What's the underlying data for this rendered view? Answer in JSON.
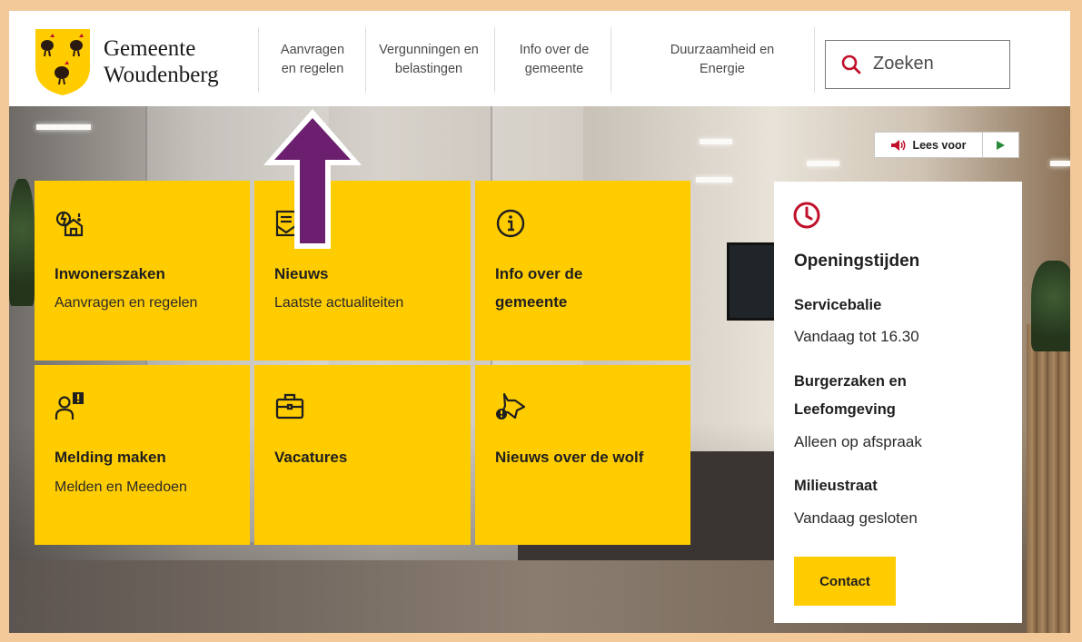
{
  "brand": {
    "line1": "Gemeente",
    "line2": "Woudenberg"
  },
  "nav": [
    {
      "label": "Aanvragen en regelen"
    },
    {
      "label": "Vergunningen en belastingen"
    },
    {
      "label": "Info over de gemeente"
    },
    {
      "label": "Duurzaamheid en Energie"
    }
  ],
  "search": {
    "placeholder": "Zoeken"
  },
  "readspeaker": {
    "label": "Lees voor"
  },
  "tiles": [
    {
      "title": "Inwonerszaken",
      "subtitle": "Aanvragen en regelen",
      "icon": "house-energy-icon"
    },
    {
      "title": "Nieuws",
      "subtitle": "Laatste actualiteiten",
      "icon": "news-icon"
    },
    {
      "title": "Info over de gemeente",
      "subtitle": "",
      "icon": "info-icon"
    },
    {
      "title": "Melding maken",
      "subtitle": "Melden en Meedoen",
      "icon": "person-alert-icon"
    },
    {
      "title": "Vacatures",
      "subtitle": "",
      "icon": "briefcase-icon"
    },
    {
      "title": "Nieuws over de wolf",
      "subtitle": "",
      "icon": "wolf-alert-icon"
    }
  ],
  "opening_hours": {
    "title": "Openingstijden",
    "entries": [
      {
        "label": "Servicebalie",
        "value": "Vandaag tot 16.30"
      },
      {
        "label": "Burgerzaken en Leefomgeving",
        "value": "Alleen op afspraak"
      },
      {
        "label": "Milieustraat",
        "value": "Vandaag gesloten"
      }
    ],
    "contact_label": "Contact"
  },
  "colors": {
    "accent_yellow": "#ffcc00",
    "clock_red": "#c0102b",
    "arrow_purple": "#6b1f6e",
    "frame_orange": "#f3c99a"
  }
}
